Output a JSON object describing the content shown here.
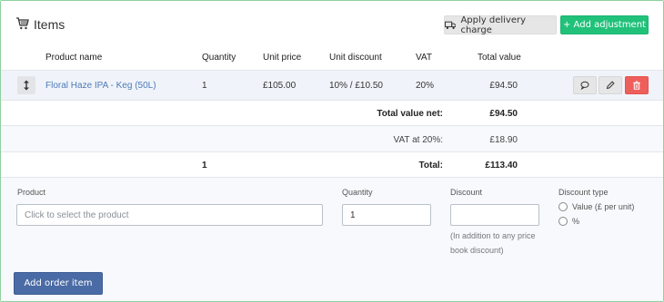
{
  "header": {
    "title": "Items",
    "icon": "shopping-cart-icon",
    "delivery_button": "Apply delivery charge",
    "adjustment_button": "+ Add adjustment"
  },
  "table": {
    "columns": [
      "Product name",
      "Quantity",
      "Unit price",
      "Unit discount",
      "VAT",
      "Total value"
    ],
    "rows": [
      {
        "product": "Floral Haze IPA - Keg (50L)",
        "quantity": "1",
        "unit_price": "£105.00",
        "unit_discount": "10% / £10.50",
        "vat": "20%",
        "total": "£94.50"
      }
    ]
  },
  "summary": {
    "net_label": "Total value net:",
    "net_value": "£94.50",
    "vat_label": "VAT at 20%:",
    "vat_value": "£18.90",
    "total_quantity": "1",
    "total_label": "Total:",
    "total_value": "£113.40"
  },
  "form": {
    "product_label": "Product",
    "product_placeholder": "Click to select the product",
    "quantity_label": "Quantity",
    "quantity_value": "1",
    "discount_label": "Discount",
    "discount_value": "",
    "discount_help": "(In addition to any price book discount)",
    "discount_type_label": "Discount type",
    "discount_type_options": [
      "Value (£ per unit)",
      "%"
    ],
    "add_button": "Add order item"
  },
  "colors": {
    "panel_border": "#8fd19e",
    "adjustment_button": "#21c17a",
    "delete_button": "#ee5f5b",
    "product_link": "#4e79b8",
    "add_order_button": "#4a6ba5"
  }
}
